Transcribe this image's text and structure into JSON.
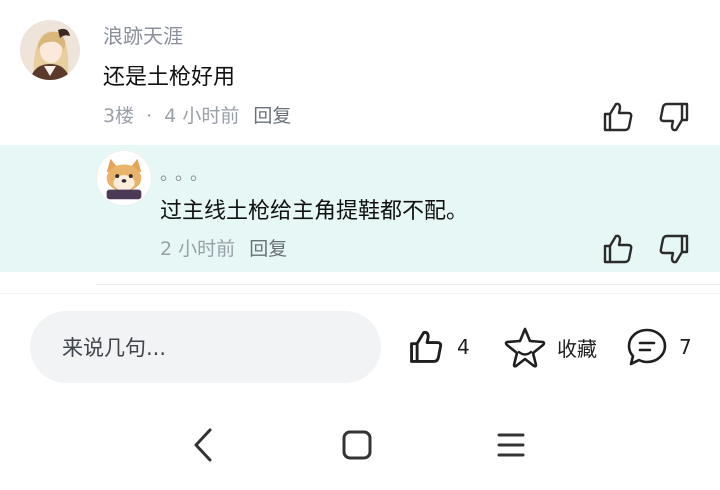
{
  "comment": {
    "username": "浪跡天涯",
    "content": "还是土枪好用",
    "floor": "3楼",
    "separator": "·",
    "time": "4 小时前",
    "reply_label": "回复",
    "avatar_icon": "anime-girl-avatar"
  },
  "reply": {
    "username": "。。。",
    "content": "过主线土枪给主角提鞋都不配。",
    "time": "2 小时前",
    "reply_label": "回复",
    "avatar_icon": "shiba-dog-avatar"
  },
  "bottom_bar": {
    "input_placeholder": "来说几句...",
    "like_count": "4",
    "favorite_label": "收藏",
    "comment_count": "7"
  },
  "colors": {
    "reply_bg": "#e6f7f5",
    "input_bg": "#f2f3f5",
    "meta_text": "#9aa0a8"
  },
  "icons": {
    "like": "thumbs-up-icon",
    "dislike": "thumbs-down-icon",
    "favorite": "star-icon",
    "comment": "comment-bubble-icon",
    "nav_back": "back-chevron-icon",
    "nav_home": "home-square-icon",
    "nav_menu": "menu-lines-icon"
  }
}
